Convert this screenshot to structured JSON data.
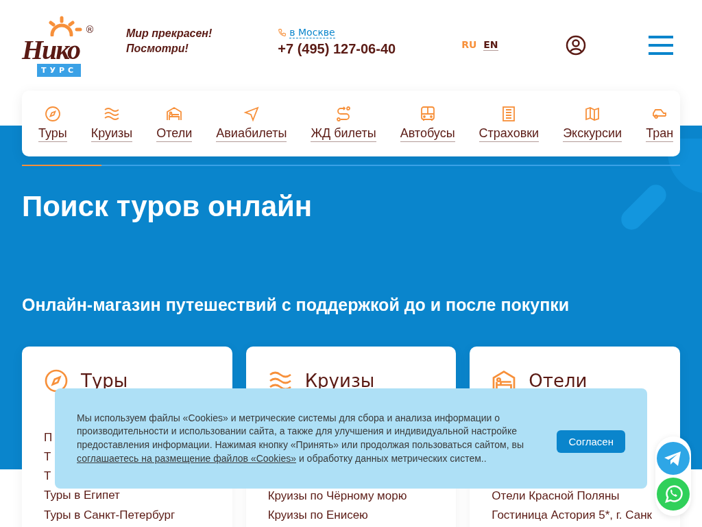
{
  "header": {
    "logo": {
      "word": "Нико",
      "sub": "ТУРС",
      "mark": "®"
    },
    "slogan": [
      "Мир прекрасен!",
      "Посмотри!"
    ],
    "city": "в Москве",
    "phone": "+7 (495) 127-06-40",
    "languages": [
      {
        "label": "RU",
        "selected": true
      },
      {
        "label": "EN",
        "selected": false
      }
    ]
  },
  "nav": [
    {
      "label": "Туры",
      "kind": "compass"
    },
    {
      "label": "Круизы",
      "kind": "waves"
    },
    {
      "label": "Отели",
      "kind": "hotel"
    },
    {
      "label": "Авиабилеты",
      "kind": "plane"
    },
    {
      "label": "ЖД билеты",
      "kind": "route"
    },
    {
      "label": "Автобусы",
      "kind": "bus"
    },
    {
      "label": "Страховки",
      "kind": "document"
    },
    {
      "label": "Экскурсии",
      "kind": "map"
    },
    {
      "label": "Тран",
      "kind": "car"
    }
  ],
  "title": "Поиск туров онлайн",
  "subtitle": "Онлайн-магазин путешествий с поддержкой до и после покупки",
  "cards": [
    {
      "title": "Туры",
      "kind": "compass",
      "links": [
        "П",
        "Т",
        "Т",
        "Туры в Египет",
        "Туры в Санкт-Петербург"
      ]
    },
    {
      "title": "Круизы",
      "kind": "waves",
      "links": [
        "Круизы по Чёрному морю",
        "Круизы по Енисею"
      ]
    },
    {
      "title": "Отели",
      "kind": "hotel",
      "links": [
        "Отели Красной Поляны",
        "Гостиница Астория 5*, г. Санк"
      ]
    }
  ],
  "cookie_banner": {
    "text_before": "Мы используем файлы «Cookies» и метрические системы для сбора и анализа информации о производительности и использовании сайта, а также для улучшения и индивидуальной настройке предоставления информации. Нажимая кнопку «Принять» или продолжая пользоваться сайтом, вы ",
    "link": "соглашаетесь на размещение файлов «Cookies»",
    "text_after": " и обработку данных метрических систем..",
    "button": "Согласен"
  }
}
